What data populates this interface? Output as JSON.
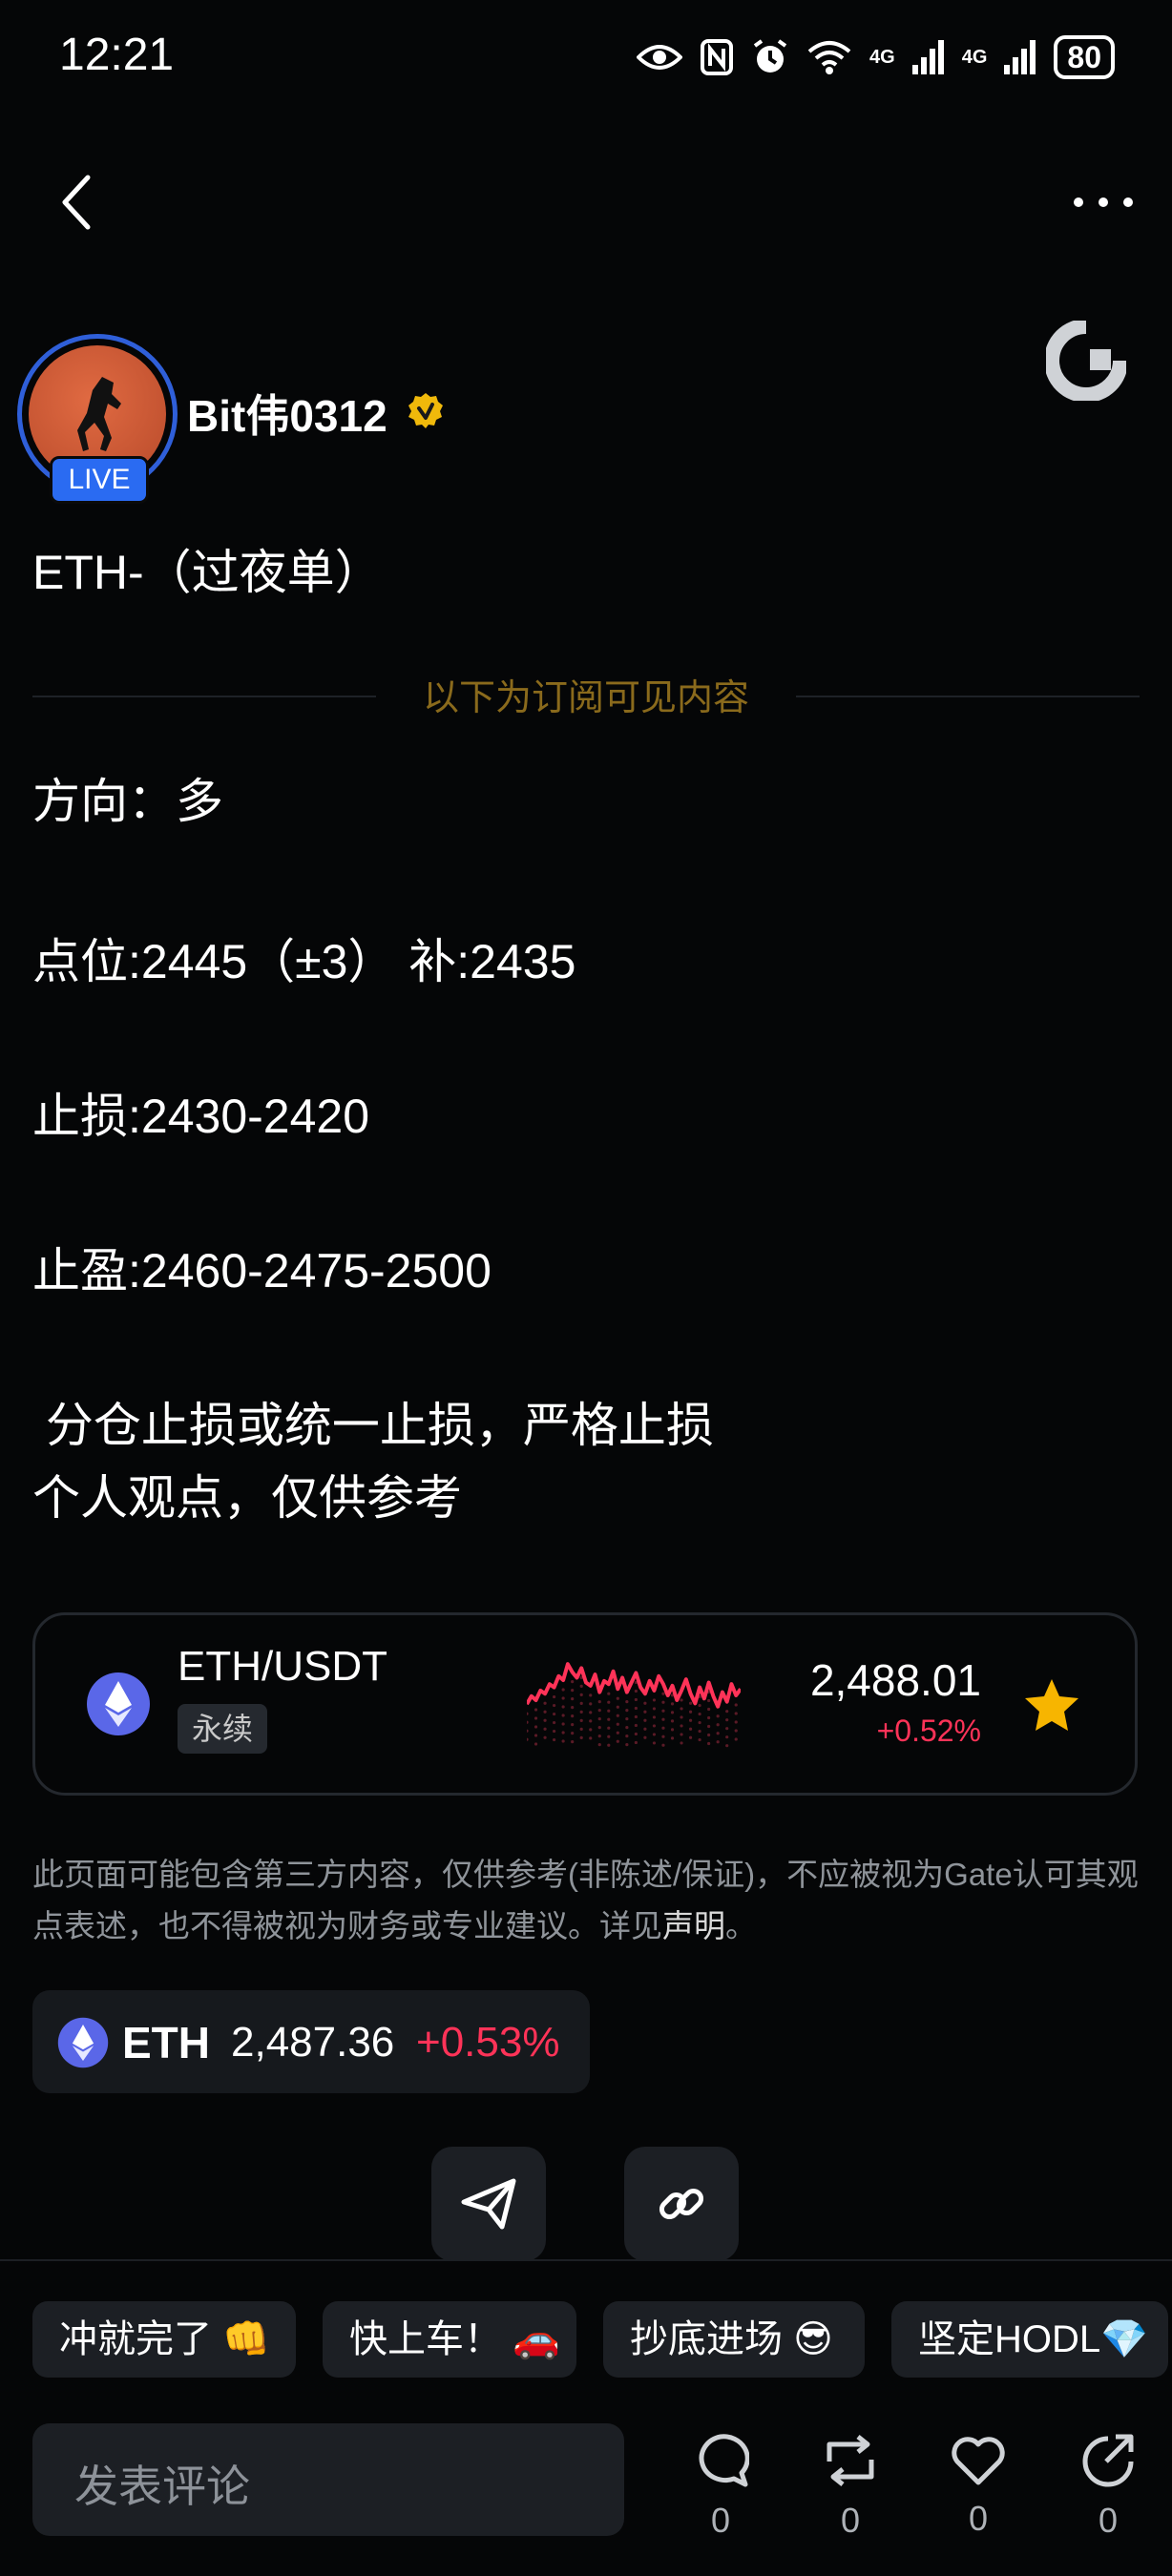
{
  "status_bar": {
    "time": "12:21",
    "net1": "4G",
    "net2": "4G",
    "battery": "80"
  },
  "author": {
    "name": "Bit伟0312",
    "live_label": "LIVE"
  },
  "post": {
    "title": "ETH-（过夜单）",
    "divider_text": "以下为订阅可见内容",
    "lines": [
      "方向：多",
      "点位:2445（±3） 补:2435",
      "止损:2430-2420",
      "止盈:2460-2475-2500",
      " 分仓止损或统一止损，严格止损",
      "个人观点，仅供参考"
    ]
  },
  "market_card": {
    "pair": "ETH/USDT",
    "type_label": "永续",
    "price": "2,488.01",
    "change": "+0.52%",
    "sparkline": [
      0.45,
      0.55,
      0.5,
      0.62,
      0.58,
      0.7,
      0.66,
      0.8,
      0.75,
      0.95,
      0.85,
      0.78,
      0.9,
      0.72,
      0.68,
      0.82,
      0.6,
      0.74,
      0.7,
      0.86,
      0.64,
      0.78,
      0.6,
      0.72,
      0.84,
      0.66,
      0.58,
      0.74,
      0.62,
      0.8,
      0.7,
      0.56,
      0.68,
      0.5,
      0.62,
      0.76,
      0.58,
      0.46,
      0.66,
      0.52,
      0.72,
      0.55,
      0.42,
      0.6,
      0.48,
      0.7,
      0.56,
      0.64
    ],
    "colors": {
      "line": "#ff3358",
      "star": "#f7b500"
    }
  },
  "disclaimer": {
    "text": "此页面可能包含第三方内容，仅供参考(非陈述/保证)，不应被视为Gate认可其观点表述，也不得被视为财务或专业建议。详见",
    "link": "声明",
    "end": "。"
  },
  "ticker": {
    "symbol": "ETH",
    "price": "2,487.36",
    "change": "+0.53%"
  },
  "quick_replies": [
    "冲就完了 👊",
    "快上车！ 🚗",
    "抄底进场 😎",
    "坚定HODL💎"
  ],
  "comment": {
    "placeholder": "发表评论"
  },
  "actions": [
    {
      "icon": "comment-icon",
      "count": "0"
    },
    {
      "icon": "repost-icon",
      "count": "0"
    },
    {
      "icon": "like-icon",
      "count": "0"
    },
    {
      "icon": "share-icon",
      "count": "0"
    }
  ]
}
